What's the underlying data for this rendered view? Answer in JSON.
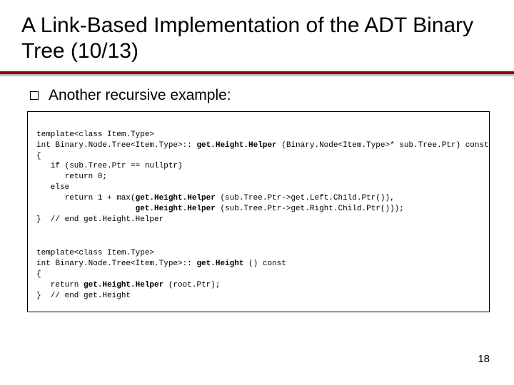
{
  "title": "A Link-Based Implementation of the ADT Binary Tree (10/13)",
  "bullet": "Another recursive example:",
  "code1": {
    "l1a": "template<class Item.Type>",
    "l2a": "int Binary.Node.Tree<Item.Type>:: ",
    "l2b": "get.Height.Helper",
    "l2c": " (Binary.Node<Item.Type>* sub.Tree.Ptr) const",
    "l3a": "{",
    "l4a": "   if (sub.Tree.Ptr == nullptr)",
    "l5a": "      return 0;",
    "l6a": "   else",
    "l7a": "      return 1 + max(",
    "l7b": "get.Height.Helper",
    "l7c": " (sub.Tree.Ptr->get.Left.Child.Ptr()),",
    "l8a": "                     ",
    "l8b": "get.Height.Helper",
    "l8c": " (sub.Tree.Ptr->get.Right.Child.Ptr()));",
    "l9a": "}  // end get.Height.Helper"
  },
  "code2": {
    "l1a": "template<class Item.Type>",
    "l2a": "int Binary.Node.Tree<Item.Type>:: ",
    "l2b": "get.Height",
    "l2c": " () const",
    "l3a": "{",
    "l4a": "   return ",
    "l4b": "get.Height.Helper",
    "l4c": " (root.Ptr);",
    "l5a": "}  // end get.Height"
  },
  "page_number": "18"
}
